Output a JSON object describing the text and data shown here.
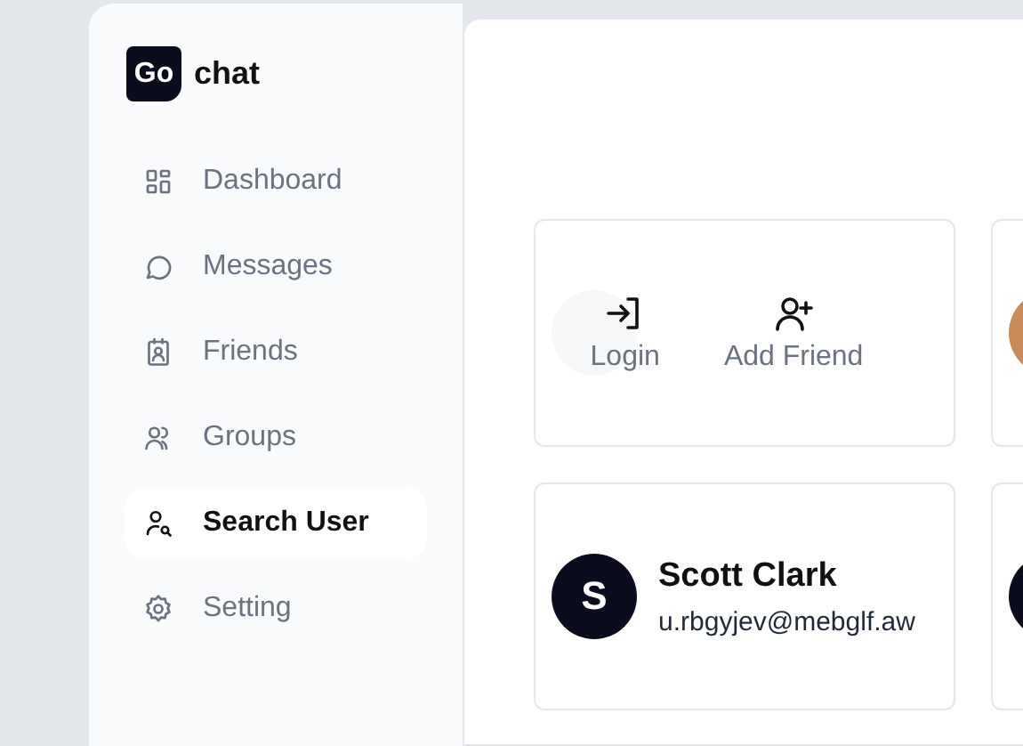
{
  "brand": {
    "mark": "Go",
    "name": "chat"
  },
  "nav": [
    {
      "label": "Dashboard",
      "selected": false
    },
    {
      "label": "Messages",
      "selected": false
    },
    {
      "label": "Friends",
      "selected": false
    },
    {
      "label": "Groups",
      "selected": false
    },
    {
      "label": "Search User",
      "selected": true
    },
    {
      "label": "Setting",
      "selected": false
    }
  ],
  "users": [
    {
      "kind": "initial",
      "hovered": true,
      "actions": [
        {
          "label": "Login"
        },
        {
          "label": "Add Friend"
        }
      ]
    },
    {
      "kind": "photo",
      "hovered": false
    },
    {
      "kind": "initial",
      "initial": "S",
      "name": "Scott Clark",
      "email": "u.rbgyjev@mebglf.aw",
      "hovered": false
    },
    {
      "kind": "initial",
      "hovered": false
    }
  ]
}
